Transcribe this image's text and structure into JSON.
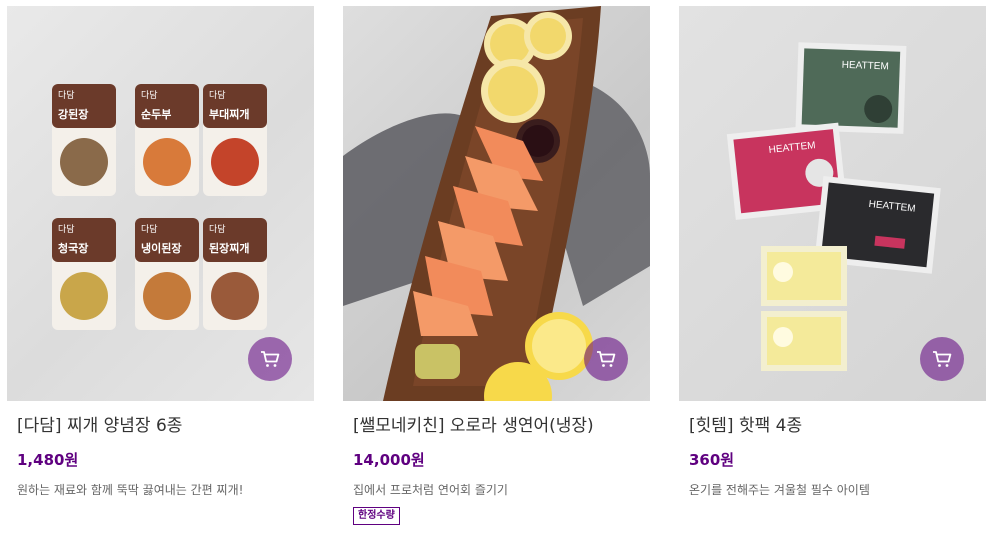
{
  "products": [
    {
      "name": "[다담] 찌개 양념장 6종",
      "price": "1,480원",
      "description": "원하는 재료와 함께 뚝딱 끓여내는 간편 찌개!",
      "badge": null,
      "image_icon": "stew-sauce-packs-image",
      "pack_brand": "다담",
      "pack_names": [
        "강된장",
        "순두부",
        "부대찌개",
        "청국장",
        "냉이된장",
        "된장찌개"
      ]
    },
    {
      "name": "[쌜모네키친] 오로라 생연어(냉장)",
      "price": "14,000원",
      "description": "집에서 프로처럼 연어회 즐기기",
      "badge": "한정수량",
      "image_icon": "salmon-board-image"
    },
    {
      "name": "[힛템] 핫팩 4종",
      "price": "360원",
      "description": "온기를 전해주는 겨울철 필수 아이템",
      "badge": null,
      "image_icon": "heat-pack-image",
      "pack_brand": "HEATTEM"
    }
  ],
  "cart_icon": "cart-icon",
  "colors": {
    "accent": "#5f0080",
    "cart_bg": "rgba(95,0,128,0.55)"
  }
}
